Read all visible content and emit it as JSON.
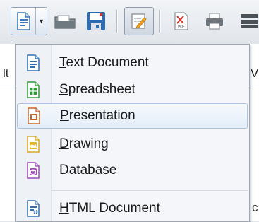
{
  "toolbar": {
    "buttons": [
      {
        "name": "new-document",
        "icon": "new-document-icon"
      },
      {
        "name": "dropdown-arrow",
        "icon": "chevron-down-icon",
        "glyph": "▾"
      },
      {
        "name": "open",
        "icon": "open-folder-icon"
      },
      {
        "name": "save",
        "icon": "save-icon"
      },
      {
        "name": "edit-mode",
        "icon": "edit-document-icon"
      },
      {
        "name": "export-pdf",
        "icon": "pdf-icon"
      }
    ]
  },
  "background": {
    "left_letter": "lt",
    "right_letter_top": "V",
    "right_letter_bottom": "c"
  },
  "menu": {
    "items": [
      {
        "pre": "",
        "mn": "T",
        "post": "ext Document",
        "icon": "text-document-icon",
        "color": "#2f6fb3"
      },
      {
        "pre": "",
        "mn": "S",
        "post": "preadsheet",
        "icon": "spreadsheet-icon",
        "color": "#2e9c3b"
      },
      {
        "pre": "",
        "mn": "P",
        "post": "resentation",
        "icon": "presentation-icon",
        "color": "#c8642a"
      },
      {
        "pre": "",
        "mn": "D",
        "post": "rawing",
        "icon": "drawing-icon",
        "color": "#d9a522"
      },
      {
        "pre": "Data",
        "mn": "b",
        "post": "ase",
        "icon": "database-icon",
        "color": "#9b4bb5"
      },
      {
        "pre": "",
        "mn": "H",
        "post": "TML Document",
        "icon": "html-document-icon",
        "color": "#3b6ea8"
      }
    ],
    "hovered_index": 2
  }
}
